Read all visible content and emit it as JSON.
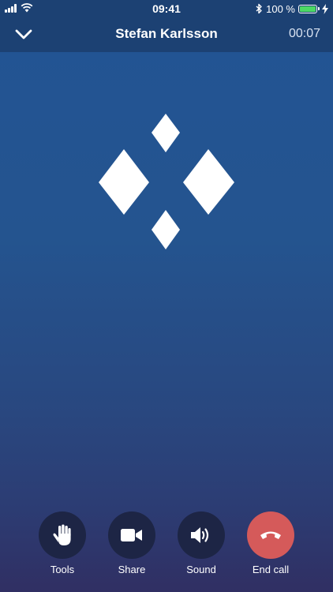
{
  "status_bar": {
    "time": "09:41",
    "battery_percent": "100 %",
    "battery_level": 1.0,
    "icons": [
      "signal-icon",
      "wifi-icon",
      "bluetooth-icon",
      "battery-icon",
      "charging-icon"
    ]
  },
  "header": {
    "title": "Stefan Karlsson",
    "timer": "00:07",
    "collapse_icon": "chevron-down-icon"
  },
  "logo": {
    "icon": "diamond-logo-icon"
  },
  "controls": [
    {
      "label": "Tools",
      "icon": "hand-icon"
    },
    {
      "label": "Share",
      "icon": "video-camera-icon"
    },
    {
      "label": "Sound",
      "icon": "speaker-icon"
    },
    {
      "label": "End call",
      "icon": "hang-up-icon",
      "color": "#d55a5a"
    }
  ],
  "colors": {
    "background_top": "#225494",
    "background_bottom": "#302f63",
    "header_bar": "#1c4173",
    "control_button": "#1d2545",
    "end_call": "#d55a5a",
    "battery_fill": "#4cd964"
  }
}
